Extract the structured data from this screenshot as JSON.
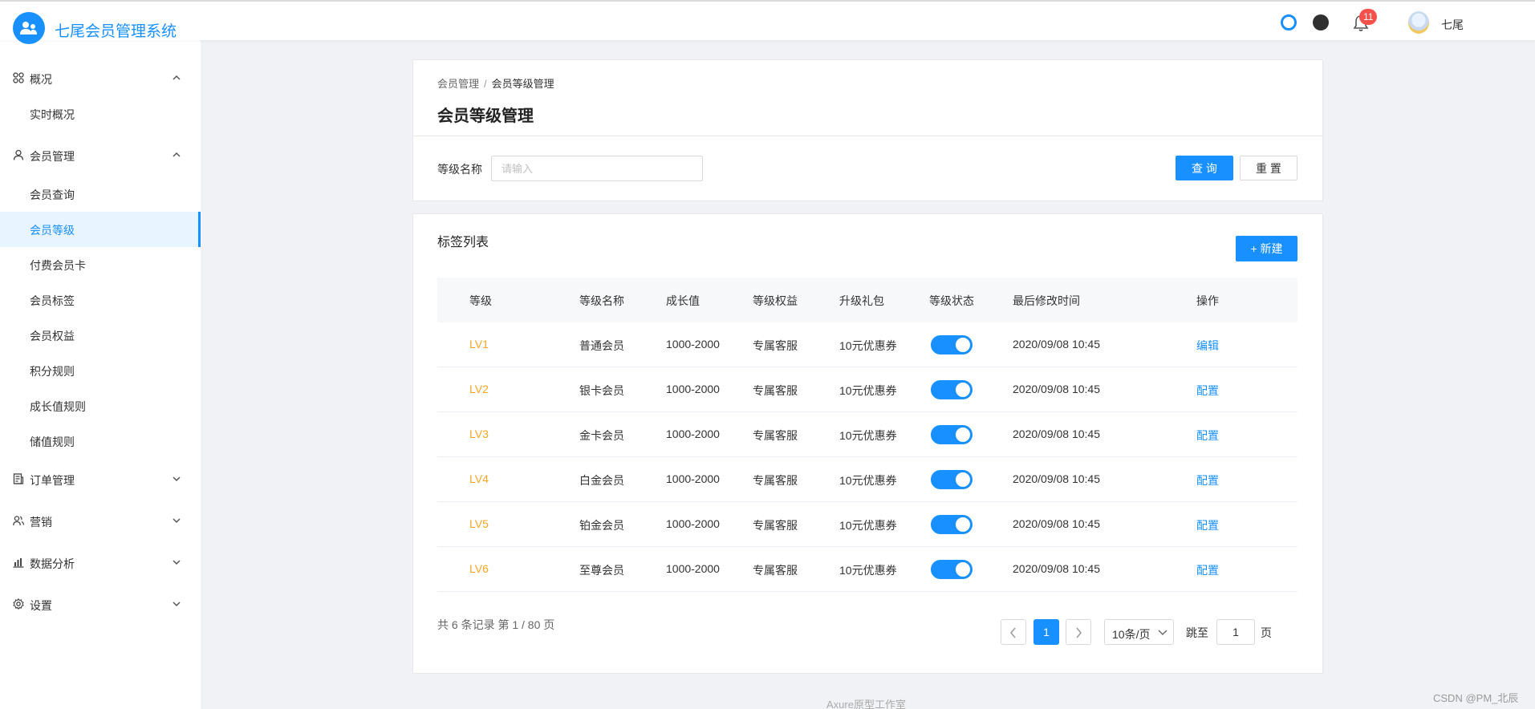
{
  "header": {
    "app_title": "七尾会员管理系统",
    "notification_count": "11",
    "user_name": "七尾",
    "brand_color": "#1890ff"
  },
  "sidebar": {
    "groups": [
      {
        "label": "概况",
        "icon": "grid-icon",
        "expanded": true,
        "items": [
          "实时概况"
        ]
      },
      {
        "label": "会员管理",
        "icon": "user-icon",
        "expanded": true,
        "items": [
          "会员查询",
          "会员等级",
          "付费会员卡",
          "会员标签",
          "会员权益",
          "积分规则",
          "成长值规则",
          "储值规则"
        ],
        "active": "会员等级"
      },
      {
        "label": "订单管理",
        "icon": "order-icon",
        "expanded": false
      },
      {
        "label": "营销",
        "icon": "users-icon",
        "expanded": false
      },
      {
        "label": "数据分析",
        "icon": "bar-chart-icon",
        "expanded": false
      },
      {
        "label": "设置",
        "icon": "gear-icon",
        "expanded": false
      }
    ]
  },
  "page": {
    "breadcrumb": [
      "会员管理",
      "/",
      "会员等级管理"
    ],
    "title": "会员等级管理"
  },
  "filter": {
    "label": "等级名称",
    "placeholder": "请输入",
    "value": "",
    "query_label": "查 询",
    "reset_label": "重 置"
  },
  "list": {
    "title": "标签列表",
    "new_label": "+ 新建",
    "columns": [
      "等级",
      "等级名称",
      "成长值",
      "等级权益",
      "升级礼包",
      "等级状态",
      "最后修改时间",
      "操作"
    ],
    "rows": [
      {
        "level": "LV1",
        "name": "普通会员",
        "growth": "1000-2000",
        "benefit": "专属客服",
        "gift": "10元优惠券",
        "enabled": true,
        "modified": "2020/09/08 10:45",
        "action": "编辑"
      },
      {
        "level": "LV2",
        "name": "银卡会员",
        "growth": "1000-2000",
        "benefit": "专属客服",
        "gift": "10元优惠券",
        "enabled": true,
        "modified": "2020/09/08 10:45",
        "action": "配置"
      },
      {
        "level": "LV3",
        "name": "金卡会员",
        "growth": "1000-2000",
        "benefit": "专属客服",
        "gift": "10元优惠券",
        "enabled": true,
        "modified": "2020/09/08 10:45",
        "action": "配置"
      },
      {
        "level": "LV4",
        "name": "白金会员",
        "growth": "1000-2000",
        "benefit": "专属客服",
        "gift": "10元优惠券",
        "enabled": true,
        "modified": "2020/09/08 10:45",
        "action": "配置"
      },
      {
        "level": "LV5",
        "name": "铂金会员",
        "growth": "1000-2000",
        "benefit": "专属客服",
        "gift": "10元优惠券",
        "enabled": true,
        "modified": "2020/09/08 10:45",
        "action": "配置"
      },
      {
        "level": "LV6",
        "name": "至尊会员",
        "growth": "1000-2000",
        "benefit": "专属客服",
        "gift": "10元优惠券",
        "enabled": true,
        "modified": "2020/09/08 10:45",
        "action": "配置"
      }
    ],
    "level_color": "#f5a623"
  },
  "pagination": {
    "summary": "共 6 条记录 第 1 / 80 页",
    "current_page": "1",
    "page_size": "10条/页",
    "jump_label": "跳至",
    "jump_value": "1",
    "page_suffix": "页"
  },
  "footer": {
    "text": "Axure原型工作室",
    "watermark": "CSDN @PM_北辰"
  }
}
